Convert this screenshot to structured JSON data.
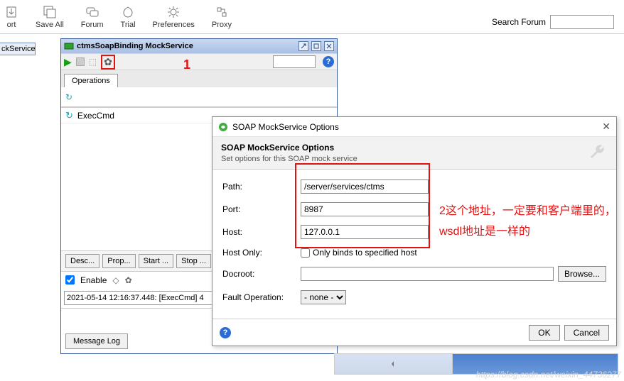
{
  "toolbar": {
    "items": [
      {
        "label": "ort",
        "icon": "import-icon"
      },
      {
        "label": "Save All",
        "icon": "save-all-icon"
      },
      {
        "label": "Forum",
        "icon": "forum-icon"
      },
      {
        "label": "Trial",
        "icon": "trial-icon"
      },
      {
        "label": "Preferences",
        "icon": "preferences-icon"
      },
      {
        "label": "Proxy",
        "icon": "proxy-icon"
      }
    ],
    "search_label": "Search Forum"
  },
  "left_fragment": "ckService",
  "mock_window": {
    "title": "ctmsSoapBinding MockService",
    "tab": "Operations",
    "op_item": "ExecCmd",
    "buttons": {
      "desc": "Desc...",
      "prop": "Prop...",
      "start": "Start ...",
      "stop": "Stop ..."
    },
    "enable_label": "Enable",
    "log_line": "2021-05-14 12:16:37.448: [ExecCmd] 4",
    "msg_log": "Message Log"
  },
  "dialog": {
    "title": "SOAP MockService Options",
    "head": "SOAP MockService Options",
    "sub": "Set options for this SOAP mock service",
    "labels": {
      "path": "Path:",
      "port": "Port:",
      "host": "Host:",
      "host_only": "Host Only:",
      "host_only_cb": "Only binds to specified host",
      "docroot": "Docroot:",
      "fault": "Fault Operation:"
    },
    "values": {
      "path": "/server/services/ctms",
      "port": "8987",
      "host": "127.0.0.1",
      "docroot": "",
      "fault": "- none -"
    },
    "buttons": {
      "browse": "Browse...",
      "ok": "OK",
      "cancel": "Cancel"
    }
  },
  "annotations": {
    "n1": "1",
    "n2": "2这个地址，一定要和客户端里的，wsdl地址是一样的"
  },
  "watermark": "https://blog.csdn.net/weixin_44736277"
}
